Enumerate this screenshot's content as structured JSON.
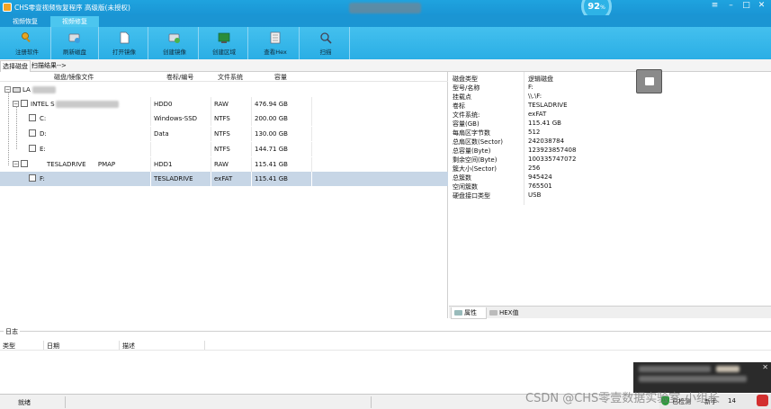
{
  "titlebar": {
    "title": "CHS零壹视频恢复程序 高级版(未授权)",
    "gauge_value": "92",
    "gauge_unit": "%"
  },
  "tabs": [
    {
      "label": "视频恢复"
    },
    {
      "label": "视频修复"
    }
  ],
  "toolbar": [
    {
      "label": "注册软件",
      "icon": "key-icon"
    },
    {
      "label": "刷新磁盘",
      "icon": "refresh-disk-icon"
    },
    {
      "label": "打开镜像",
      "icon": "open-image-icon"
    },
    {
      "label": "创建镜像",
      "icon": "create-image-icon"
    },
    {
      "label": "创建区域",
      "icon": "create-region-icon"
    },
    {
      "label": "查看Hex",
      "icon": "hex-view-icon"
    },
    {
      "label": "扫描",
      "icon": "scan-icon"
    }
  ],
  "subtabs": [
    {
      "label": "选择磁盘"
    },
    {
      "label": "扫描结果-->"
    }
  ],
  "tree": {
    "columns": [
      "磁盘/镜像文件",
      "卷标/编号",
      "文件系统",
      "容量"
    ],
    "root_label": "LA",
    "rows": [
      {
        "name": "INTEL S",
        "label": "HDD0",
        "fs": "RAW",
        "size": "476.94 GB"
      },
      {
        "name": "C:",
        "label": "Windows-SSD",
        "fs": "NTFS",
        "size": "200.00 GB"
      },
      {
        "name": "D:",
        "label": "Data",
        "fs": "NTFS",
        "size": "130.00 GB"
      },
      {
        "name": "E:",
        "label": "",
        "fs": "NTFS",
        "size": "144.71 GB"
      },
      {
        "name": "TESLADRIVE      PMAP",
        "label": "HDD1",
        "fs": "RAW",
        "size": "115.41 GB"
      },
      {
        "name": "F:",
        "label": "TESLADRIVE",
        "fs": "exFAT",
        "size": "115.41 GB"
      }
    ]
  },
  "properties": [
    {
      "k": "磁盘类型",
      "v": "逻辑磁盘"
    },
    {
      "k": "型号/名称",
      "v": "F:"
    },
    {
      "k": "挂载点",
      "v": "\\\\.\\F:"
    },
    {
      "k": "卷标",
      "v": "TESLADRIVE"
    },
    {
      "k": "文件系统:",
      "v": "exFAT"
    },
    {
      "k": "容量(GB)",
      "v": "115.41 GB"
    },
    {
      "k": "每扇区字节数",
      "v": "512"
    },
    {
      "k": "总扇区数(Sector)",
      "v": "242038784"
    },
    {
      "k": "总容量(Byte)",
      "v": "123923857408"
    },
    {
      "k": "剩余空间(Byte)",
      "v": "100335747072"
    },
    {
      "k": "簇大小(Sector)",
      "v": "256"
    },
    {
      "k": "总簇数",
      "v": "945424"
    },
    {
      "k": "空闲簇数",
      "v": "765501"
    },
    {
      "k": "硬盘接口类型",
      "v": "USB"
    }
  ],
  "property_tabs": [
    {
      "label": "属性"
    },
    {
      "label": "HEX值"
    }
  ],
  "log": {
    "title": "日志",
    "columns": [
      "类型",
      "日期",
      "描述"
    ]
  },
  "status": {
    "text": "就绪"
  },
  "tray": {
    "item1": "已检测",
    "item2": "新手",
    "item3": "14"
  },
  "watermark": "CSDN @CHS零壹数据实验室-小组长"
}
